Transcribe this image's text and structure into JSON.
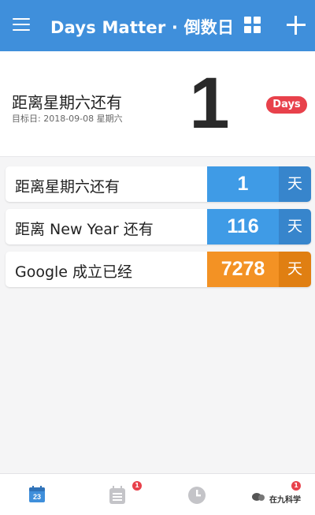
{
  "app_bar": {
    "title": "Days Matter · 倒数日",
    "menu_icon": "menu-icon",
    "grid_icon": "grid-icon",
    "add_icon": "add-icon",
    "color": "#3f8fdb"
  },
  "hero": {
    "title": "距离星期六还有",
    "target_date": "目标日: 2018-09-08 星期六",
    "days": "1",
    "badge": "Days",
    "badge_color": "#e8414b"
  },
  "events": [
    {
      "label": "距离星期六还有",
      "days": "1",
      "unit": "天",
      "color": "#3f9be6",
      "unit_color": "#3785cc"
    },
    {
      "label": "距离 New Year 还有",
      "days": "116",
      "unit": "天",
      "color": "#3f9be6",
      "unit_color": "#3785cc"
    },
    {
      "label": "Google 成立已经",
      "days": "7278",
      "unit": "天",
      "color": "#f39224",
      "unit_color": "#e07f12"
    }
  ],
  "tab_bar": {
    "tabs": [
      {
        "name": "calendar-tab",
        "icon": "calendar-icon",
        "day": "23",
        "active": true
      },
      {
        "name": "tasks-tab",
        "icon": "clipboard-icon",
        "badge": "1"
      },
      {
        "name": "clock-tab",
        "icon": "clock-icon"
      },
      {
        "name": "more-tab",
        "icon": "more-icon",
        "badge": "1"
      }
    ],
    "watermark": "在九科学"
  }
}
